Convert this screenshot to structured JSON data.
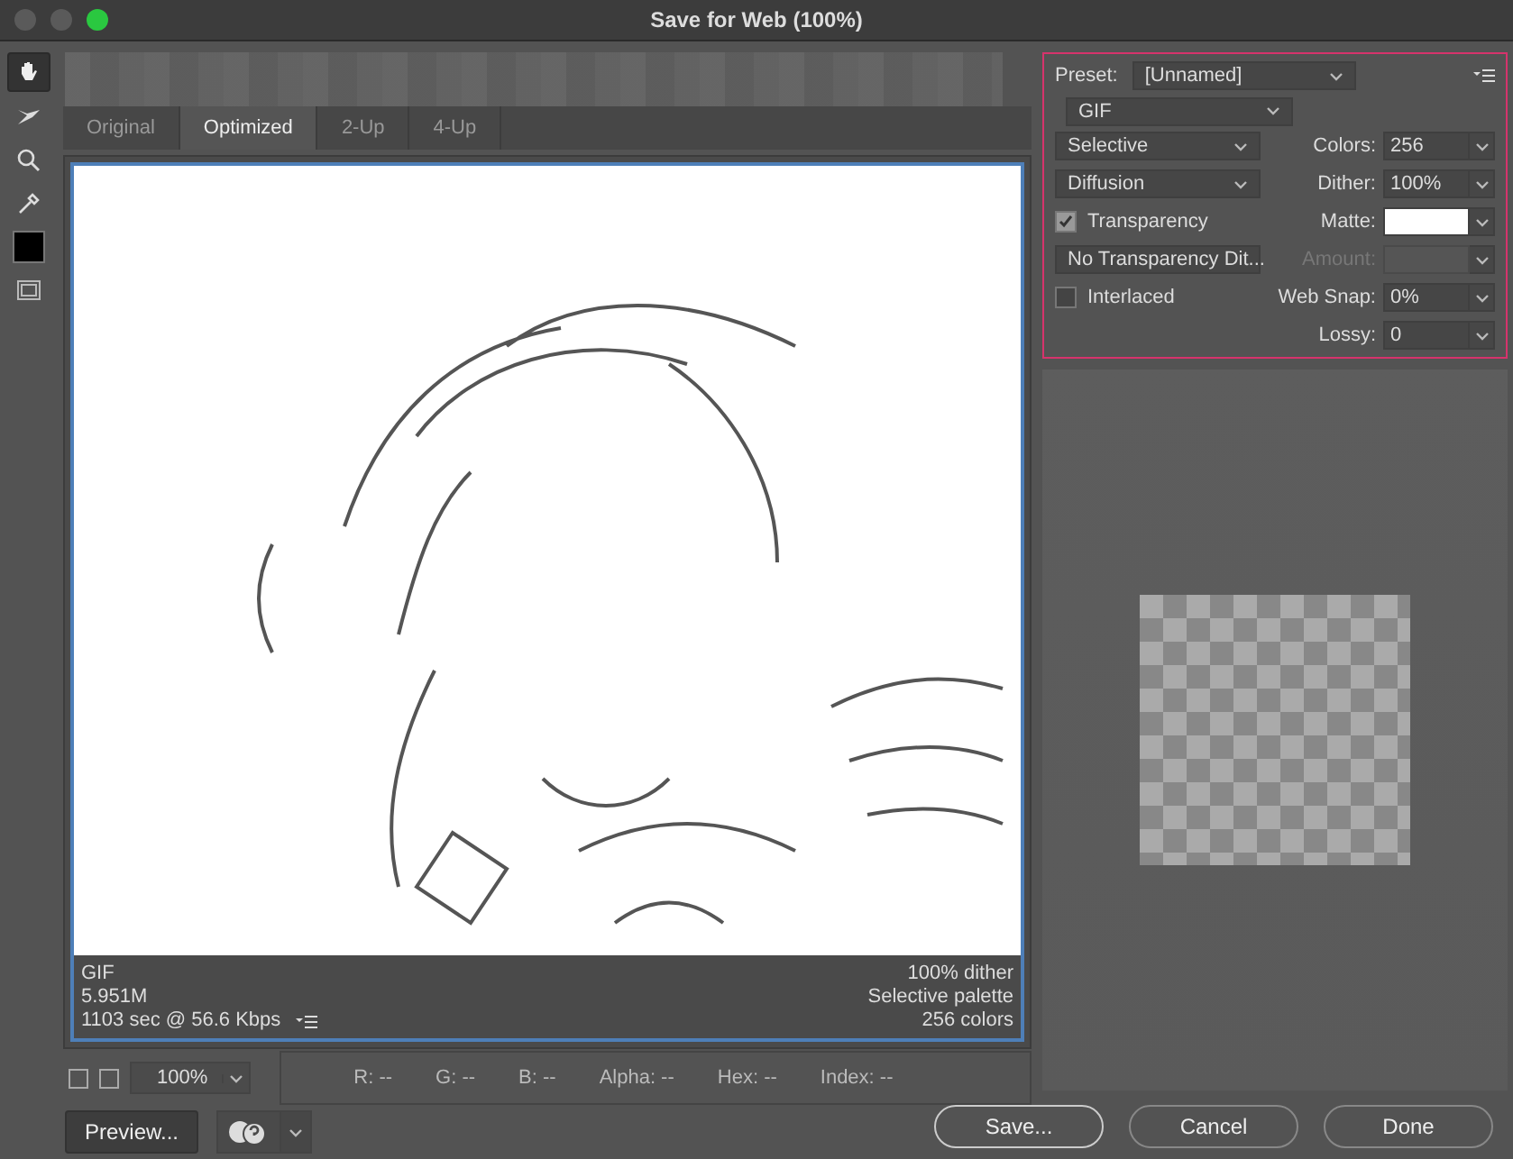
{
  "window": {
    "title": "Save for Web (100%)"
  },
  "tools": [
    {
      "kind": "hand",
      "selected": true
    },
    {
      "kind": "slice",
      "selected": false
    },
    {
      "kind": "zoom",
      "selected": false
    },
    {
      "kind": "eyedropper",
      "selected": false
    },
    {
      "kind": "swatch",
      "selected": false
    },
    {
      "kind": "slices",
      "selected": false
    }
  ],
  "tabs": [
    {
      "label": "Original",
      "selected": false
    },
    {
      "label": "Optimized",
      "selected": true
    },
    {
      "label": "2-Up",
      "selected": false
    },
    {
      "label": "4-Up",
      "selected": false
    }
  ],
  "preview_info": {
    "left": [
      "GIF",
      "5.951M",
      "1103 sec @ 56.6 Kbps"
    ],
    "right": [
      "100% dither",
      "Selective palette",
      "256 colors"
    ]
  },
  "zoom": {
    "value": "100%"
  },
  "readouts": [
    "R: --",
    "G: --",
    "B: --",
    "Alpha: --",
    "Hex: --",
    "Index: --"
  ],
  "settings": {
    "preset_label": "Preset:",
    "preset": "[Unnamed]",
    "format": "GIF",
    "left_controls": [
      {
        "kind": "dropdown",
        "value": "Selective"
      },
      {
        "kind": "dropdown",
        "value": "Diffusion"
      },
      {
        "kind": "checkbox",
        "label": "Transparency",
        "checked": true
      },
      {
        "kind": "dropdown",
        "value": "No Transparency Dit..."
      },
      {
        "kind": "checkbox",
        "label": "Interlaced",
        "checked": false
      },
      {
        "kind": "none"
      }
    ],
    "right_fields": [
      {
        "kind": "text",
        "label": "Colors:",
        "value": "256",
        "disabled": false
      },
      {
        "kind": "text",
        "label": "Dither:",
        "value": "100%",
        "disabled": false
      },
      {
        "kind": "swatch",
        "label": "Matte:",
        "disabled": false
      },
      {
        "kind": "text",
        "label": "Amount:",
        "disabled": true
      },
      {
        "kind": "text",
        "label": "Web Snap:",
        "value": "0%",
        "disabled": false
      },
      {
        "kind": "text",
        "label": "Lossy:",
        "value": "0",
        "disabled": false
      }
    ]
  },
  "buttons": [
    {
      "label": "Save...",
      "default": true
    },
    {
      "label": "Cancel",
      "default": false
    },
    {
      "label": "Done",
      "default": false
    }
  ],
  "preview_button": {
    "label": "Preview..."
  }
}
